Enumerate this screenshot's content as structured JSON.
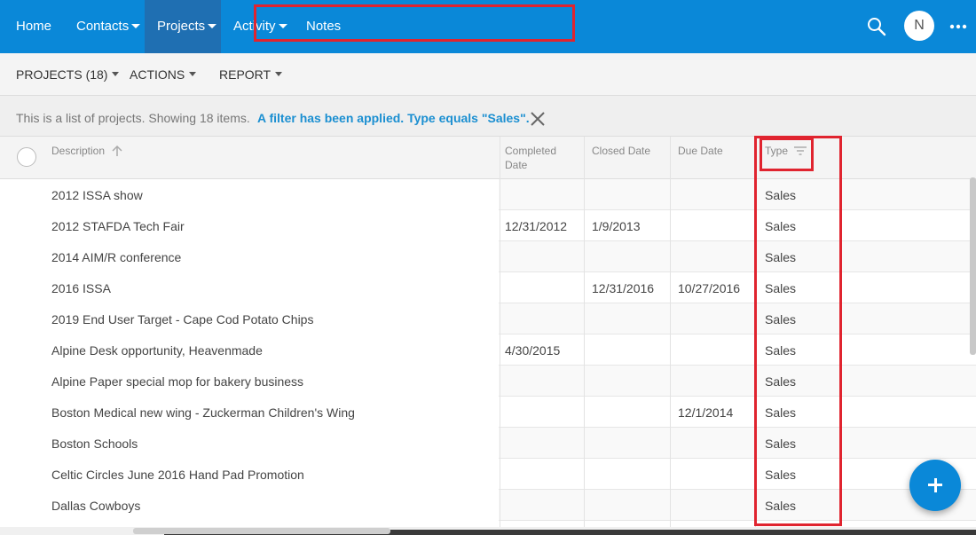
{
  "nav": {
    "items": [
      {
        "label": "Home"
      },
      {
        "label": "Contacts"
      },
      {
        "label": "Projects"
      },
      {
        "label": "Activity"
      },
      {
        "label": "Notes"
      }
    ],
    "avatar_initial": "N"
  },
  "toolbar": {
    "projects_label": "PROJECTS (18)",
    "actions_label": "ACTIONS",
    "report_label": "REPORT"
  },
  "info": {
    "text": "This is a list of projects. Showing 18 items.",
    "filter_text": "A filter has been applied. Type equals \"Sales\"."
  },
  "table": {
    "headers": {
      "description": "Description",
      "completed_line1": "Completed",
      "completed_line2": "Date",
      "closed": "Closed Date",
      "due": "Due Date",
      "type": "Type"
    },
    "rows": [
      {
        "description": "2012 ISSA show",
        "completed": "",
        "closed": "",
        "due": "",
        "type": "Sales"
      },
      {
        "description": "2012 STAFDA Tech Fair",
        "completed": "12/31/2012",
        "closed": "1/9/2013",
        "due": "",
        "type": "Sales"
      },
      {
        "description": "2014 AIM/R conference",
        "completed": "",
        "closed": "",
        "due": "",
        "type": "Sales"
      },
      {
        "description": "2016 ISSA",
        "completed": "",
        "closed": "12/31/2016",
        "due": "10/27/2016",
        "type": "Sales"
      },
      {
        "description": "2019 End User Target - Cape Cod Potato Chips",
        "completed": "",
        "closed": "",
        "due": "",
        "type": "Sales"
      },
      {
        "description": "Alpine Desk opportunity, Heavenmade",
        "completed": "4/30/2015",
        "closed": "",
        "due": "",
        "type": "Sales"
      },
      {
        "description": "Alpine Paper special mop for bakery business",
        "completed": "",
        "closed": "",
        "due": "",
        "type": "Sales"
      },
      {
        "description": "Boston Medical new wing - Zuckerman Children's Wing",
        "completed": "",
        "closed": "",
        "due": "12/1/2014",
        "type": "Sales"
      },
      {
        "description": "Boston Schools",
        "completed": "",
        "closed": "",
        "due": "",
        "type": "Sales"
      },
      {
        "description": "Celtic Circles June 2016 Hand Pad Promotion",
        "completed": "",
        "closed": "",
        "due": "",
        "type": "Sales"
      },
      {
        "description": "Dallas Cowboys",
        "completed": "",
        "closed": "",
        "due": "",
        "type": "Sales"
      }
    ]
  },
  "colors": {
    "nav_bg": "#0a88d8",
    "nav_active": "#1f6fb2",
    "highlight": "#e0242f",
    "filter_link": "#1b8fd1"
  },
  "icons": {
    "search": "search-icon",
    "more": "more-horizontal-icon",
    "sort": "arrow-up-icon",
    "filter": "filter-icon",
    "close": "close-icon",
    "add": "plus-icon"
  }
}
